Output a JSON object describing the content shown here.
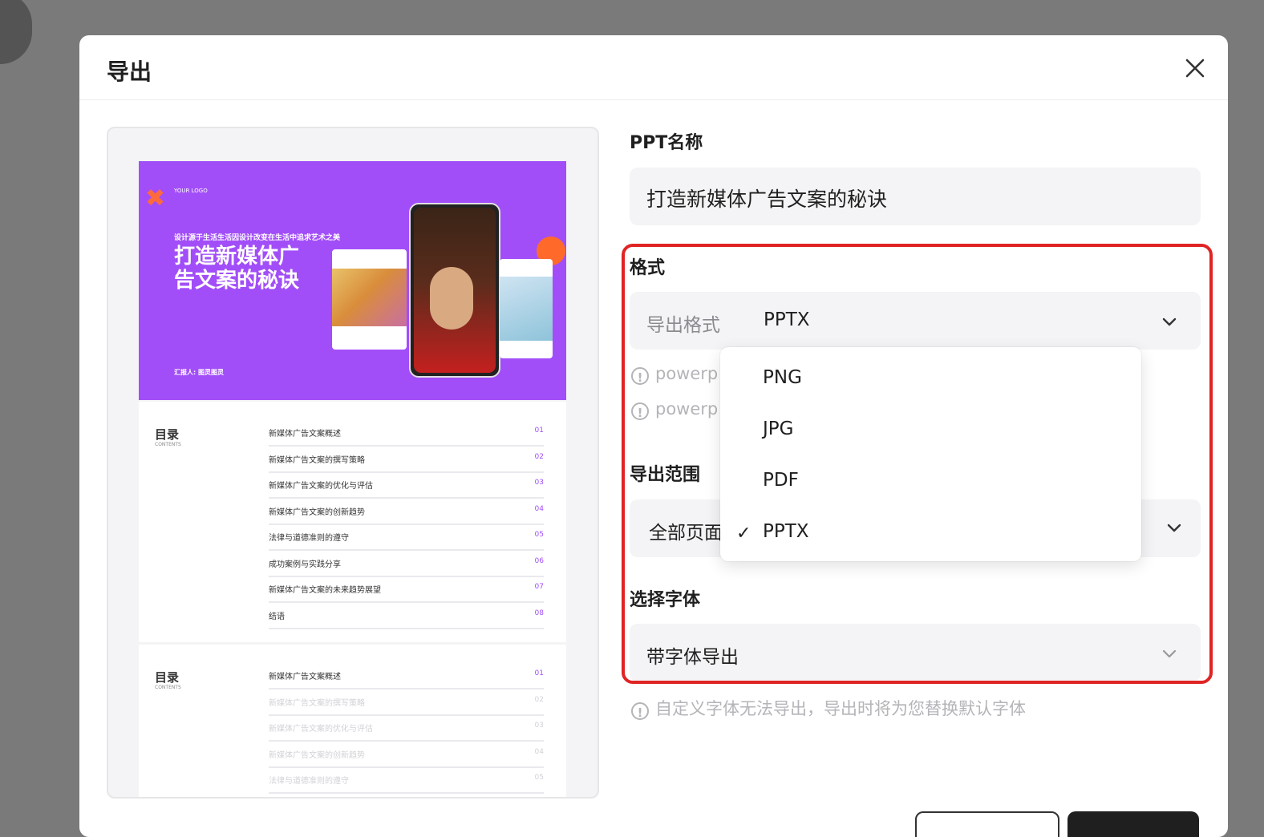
{
  "modal": {
    "title": "导出"
  },
  "preview": {
    "slide1": {
      "logo": "YOUR LOGO",
      "subtitle": "设计源于生活生活因设计改变在生活中追求艺术之美",
      "title": "打造新媒体广告文案的秘诀",
      "presenter": "汇报人: 图灵图灵"
    },
    "toc": {
      "title": "目录",
      "subtitle": "CONTENTS",
      "items": [
        {
          "label": "新媒体广告文案概述",
          "num": "01"
        },
        {
          "label": "新媒体广告文案的撰写策略",
          "num": "02"
        },
        {
          "label": "新媒体广告文案的优化与评估",
          "num": "03"
        },
        {
          "label": "新媒体广告文案的创新趋势",
          "num": "04"
        },
        {
          "label": "法律与道德准则的遵守",
          "num": "05"
        },
        {
          "label": "成功案例与实践分享",
          "num": "06"
        },
        {
          "label": "新媒体广告文案的未来趋势展望",
          "num": "07"
        },
        {
          "label": "结语",
          "num": "08"
        }
      ]
    }
  },
  "form": {
    "name_label": "PPT名称",
    "name_value": "打造新媒体广告文案的秘诀",
    "format_label": "格式",
    "format_caption": "导出格式",
    "format_value": "PPTX",
    "hint1": "powerp",
    "hint2": "powerp",
    "range_label": "导出范围",
    "range_value": "全部页面",
    "font_label": "选择字体",
    "font_value": "带字体导出",
    "font_hint": "自定义字体无法导出，导出时将为您替换默认字体"
  },
  "dropdown": {
    "options": [
      "PNG",
      "JPG",
      "PDF",
      "PPTX"
    ],
    "selected": "PPTX",
    "check_glyph": "✓"
  },
  "colors": {
    "accent_purple": "#a24ef8",
    "highlight_red": "#e02424"
  }
}
